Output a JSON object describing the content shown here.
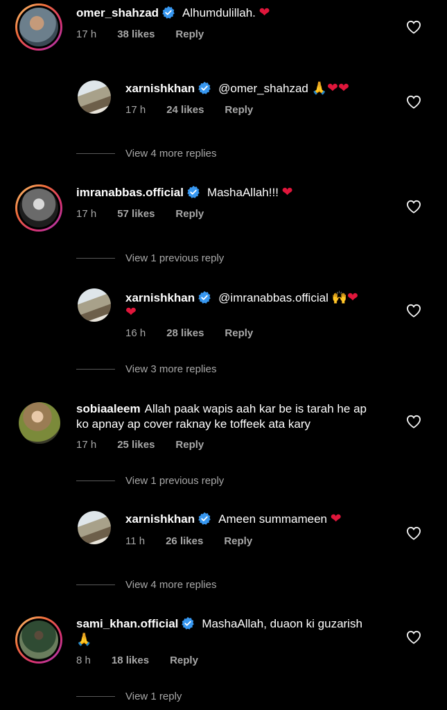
{
  "icons": {
    "verified": "verified-badge-icon",
    "like": "heart-outline-icon",
    "heart_emoji": "red-heart-emoji",
    "folded": "folded-hands-emoji",
    "raised": "raised-hands-emoji"
  },
  "colors": {
    "verified": "#3797f0",
    "heart": "#e0163b",
    "meta": "#a8a8a8"
  },
  "comments": [
    {
      "username": "omer_shahzad",
      "text": "Alhumdulillah.",
      "time": "17 h",
      "likes": "38 likes",
      "reply": "Reply"
    },
    {
      "username": "xarnishkhan",
      "text": "@omer_shahzad",
      "time": "17 h",
      "likes": "24 likes",
      "reply": "Reply",
      "view_more": "View 4 more replies"
    },
    {
      "username": "imranabbas.official",
      "text": "MashaAllah!!!",
      "time": "17 h",
      "likes": "57 likes",
      "reply": "Reply",
      "view_prev": "View 1 previous reply"
    },
    {
      "username": "xarnishkhan",
      "text": "@imranabbas.official",
      "time": "16 h",
      "likes": "28 likes",
      "reply": "Reply",
      "view_more": "View 3 more replies"
    },
    {
      "username": "sobiaaleem",
      "text": "Allah paak wapis aah kar be is tarah he ap",
      "text2": "ko apnay ap cover raknay ke toffeek ata kary",
      "time": "17 h",
      "likes": "25 likes",
      "reply": "Reply",
      "view_prev": "View 1 previous reply"
    },
    {
      "username": "xarnishkhan",
      "text": "Ameen summameen",
      "time": "11 h",
      "likes": "26 likes",
      "reply": "Reply",
      "view_more": "View 4 more replies"
    },
    {
      "username": "sami_khan.official",
      "text": "MashaAllah, duaon ki guzarish",
      "time": "8 h",
      "likes": "18 likes",
      "reply": "Reply",
      "view_more": "View 1 reply"
    }
  ]
}
